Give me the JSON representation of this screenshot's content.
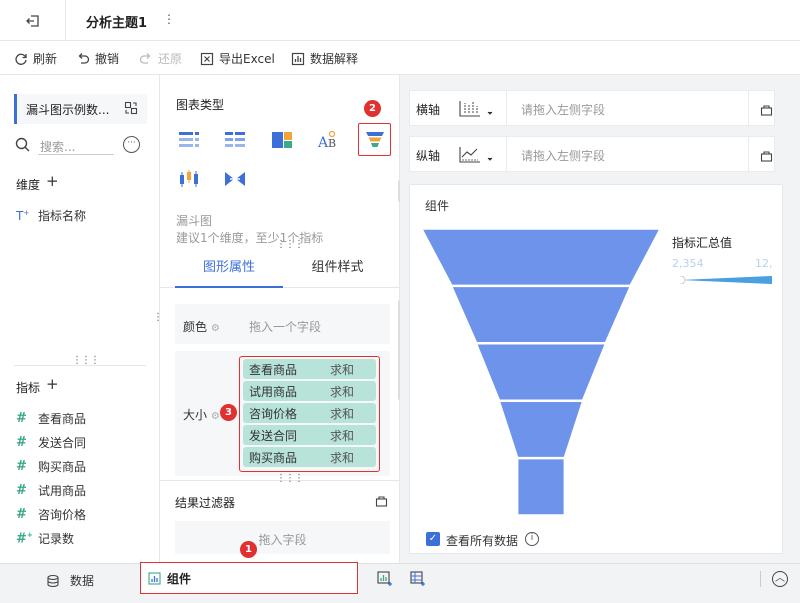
{
  "window": {
    "tab_title": "分析主题1",
    "tab_more": "⋮"
  },
  "toolbar": {
    "refresh": "刷新",
    "undo": "撤销",
    "redo": "还原",
    "export_excel": "导出Excel",
    "data_explain": "数据解释"
  },
  "left": {
    "dataset_name": "漏斗图示例数...",
    "search_placeholder": "搜索...",
    "dimension_title": "维度",
    "dimensions": [
      "指标名称"
    ],
    "measure_title": "指标",
    "measures": [
      "查看商品",
      "发送合同",
      "购买商品",
      "试用商品",
      "咨询价格",
      "记录数"
    ]
  },
  "middle": {
    "chart_type_title": "图表类型",
    "selected_chart_desc_title": "漏斗图",
    "selected_chart_desc": "建议1个维度，至少1个指标",
    "tabs": [
      "图形属性",
      "组件样式"
    ],
    "color_label": "颜色",
    "color_placeholder": "拖入一个字段",
    "size_label": "大小",
    "size_fields": [
      {
        "name": "查看商品",
        "agg": "求和"
      },
      {
        "name": "试用商品",
        "agg": "求和"
      },
      {
        "name": "咨询价格",
        "agg": "求和"
      },
      {
        "name": "发送合同",
        "agg": "求和"
      },
      {
        "name": "购买商品",
        "agg": "求和"
      }
    ],
    "filter_title": "结果过滤器",
    "filter_placeholder": "拖入字段"
  },
  "right": {
    "x_axis_label": "横轴",
    "y_axis_label": "纵轴",
    "axis_placeholder": "请拖入左侧字段",
    "chart_title": "组件",
    "legend_title": "指标汇总值",
    "legend_min": "2,354",
    "legend_max": "12,",
    "show_all_data": "查看所有数据"
  },
  "bottom": {
    "data_tab": "数据",
    "component_tab": "组件"
  },
  "badges": [
    "1",
    "2",
    "3"
  ],
  "colors": {
    "accent": "#3d6fd8",
    "funnel": "#6e93ea",
    "highlight": "#e03030",
    "pill": "#b8e3d9"
  },
  "chart_data": {
    "type": "funnel",
    "title": "组件",
    "series": [
      {
        "values": [
          12000,
          9000,
          6500,
          4200,
          2354
        ]
      }
    ],
    "legend": {
      "title": "指标汇总值",
      "min": 2354,
      "placement": "top-right"
    }
  }
}
